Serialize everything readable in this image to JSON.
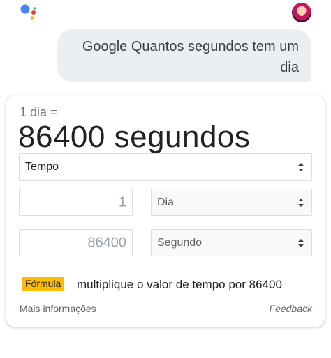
{
  "query": {
    "text": "Google Quantos segundos tem um dia"
  },
  "assistant_logo": {
    "icon": "google-assistant-icon",
    "colors": [
      "#4285f4",
      "#ea4335",
      "#fbbc04",
      "#34a853"
    ]
  },
  "avatar": {
    "icon": "user-avatar"
  },
  "converter": {
    "equation_input": "1 dia =",
    "equation_result": "86400 segundos",
    "unit_type": "Tempo",
    "from_value": "1",
    "from_unit": "Dia",
    "to_value": "86400",
    "to_unit": "Segundo",
    "formula_label": "Fórmula",
    "formula_text": "multiplique o valor de tempo por 86400",
    "more_info": "Mais informações",
    "feedback": "Feedback",
    "accent_color": "#fbbc04"
  }
}
